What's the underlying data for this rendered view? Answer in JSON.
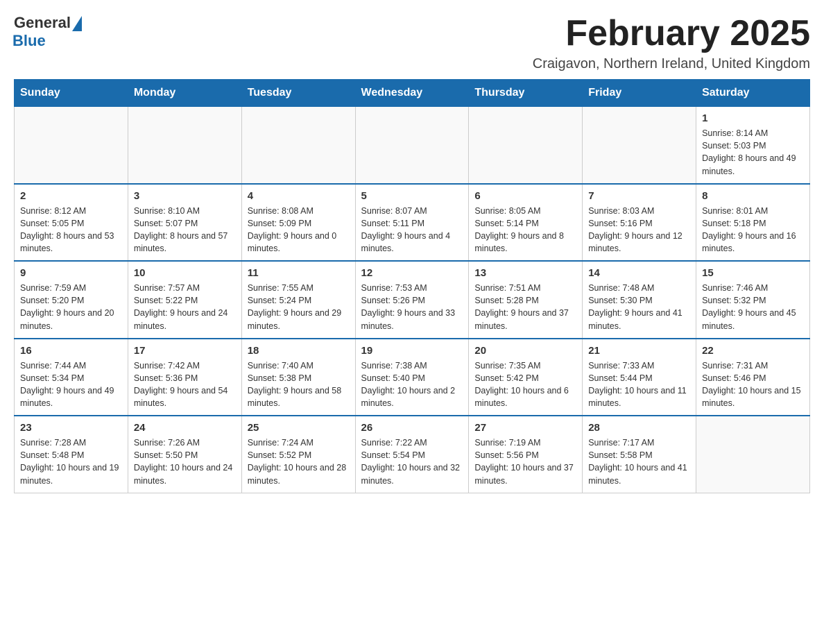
{
  "header": {
    "logo_general": "General",
    "logo_blue": "Blue",
    "month_title": "February 2025",
    "location": "Craigavon, Northern Ireland, United Kingdom"
  },
  "days_of_week": [
    "Sunday",
    "Monday",
    "Tuesday",
    "Wednesday",
    "Thursday",
    "Friday",
    "Saturday"
  ],
  "weeks": [
    [
      {
        "day": "",
        "info": ""
      },
      {
        "day": "",
        "info": ""
      },
      {
        "day": "",
        "info": ""
      },
      {
        "day": "",
        "info": ""
      },
      {
        "day": "",
        "info": ""
      },
      {
        "day": "",
        "info": ""
      },
      {
        "day": "1",
        "info": "Sunrise: 8:14 AM\nSunset: 5:03 PM\nDaylight: 8 hours and 49 minutes."
      }
    ],
    [
      {
        "day": "2",
        "info": "Sunrise: 8:12 AM\nSunset: 5:05 PM\nDaylight: 8 hours and 53 minutes."
      },
      {
        "day": "3",
        "info": "Sunrise: 8:10 AM\nSunset: 5:07 PM\nDaylight: 8 hours and 57 minutes."
      },
      {
        "day": "4",
        "info": "Sunrise: 8:08 AM\nSunset: 5:09 PM\nDaylight: 9 hours and 0 minutes."
      },
      {
        "day": "5",
        "info": "Sunrise: 8:07 AM\nSunset: 5:11 PM\nDaylight: 9 hours and 4 minutes."
      },
      {
        "day": "6",
        "info": "Sunrise: 8:05 AM\nSunset: 5:14 PM\nDaylight: 9 hours and 8 minutes."
      },
      {
        "day": "7",
        "info": "Sunrise: 8:03 AM\nSunset: 5:16 PM\nDaylight: 9 hours and 12 minutes."
      },
      {
        "day": "8",
        "info": "Sunrise: 8:01 AM\nSunset: 5:18 PM\nDaylight: 9 hours and 16 minutes."
      }
    ],
    [
      {
        "day": "9",
        "info": "Sunrise: 7:59 AM\nSunset: 5:20 PM\nDaylight: 9 hours and 20 minutes."
      },
      {
        "day": "10",
        "info": "Sunrise: 7:57 AM\nSunset: 5:22 PM\nDaylight: 9 hours and 24 minutes."
      },
      {
        "day": "11",
        "info": "Sunrise: 7:55 AM\nSunset: 5:24 PM\nDaylight: 9 hours and 29 minutes."
      },
      {
        "day": "12",
        "info": "Sunrise: 7:53 AM\nSunset: 5:26 PM\nDaylight: 9 hours and 33 minutes."
      },
      {
        "day": "13",
        "info": "Sunrise: 7:51 AM\nSunset: 5:28 PM\nDaylight: 9 hours and 37 minutes."
      },
      {
        "day": "14",
        "info": "Sunrise: 7:48 AM\nSunset: 5:30 PM\nDaylight: 9 hours and 41 minutes."
      },
      {
        "day": "15",
        "info": "Sunrise: 7:46 AM\nSunset: 5:32 PM\nDaylight: 9 hours and 45 minutes."
      }
    ],
    [
      {
        "day": "16",
        "info": "Sunrise: 7:44 AM\nSunset: 5:34 PM\nDaylight: 9 hours and 49 minutes."
      },
      {
        "day": "17",
        "info": "Sunrise: 7:42 AM\nSunset: 5:36 PM\nDaylight: 9 hours and 54 minutes."
      },
      {
        "day": "18",
        "info": "Sunrise: 7:40 AM\nSunset: 5:38 PM\nDaylight: 9 hours and 58 minutes."
      },
      {
        "day": "19",
        "info": "Sunrise: 7:38 AM\nSunset: 5:40 PM\nDaylight: 10 hours and 2 minutes."
      },
      {
        "day": "20",
        "info": "Sunrise: 7:35 AM\nSunset: 5:42 PM\nDaylight: 10 hours and 6 minutes."
      },
      {
        "day": "21",
        "info": "Sunrise: 7:33 AM\nSunset: 5:44 PM\nDaylight: 10 hours and 11 minutes."
      },
      {
        "day": "22",
        "info": "Sunrise: 7:31 AM\nSunset: 5:46 PM\nDaylight: 10 hours and 15 minutes."
      }
    ],
    [
      {
        "day": "23",
        "info": "Sunrise: 7:28 AM\nSunset: 5:48 PM\nDaylight: 10 hours and 19 minutes."
      },
      {
        "day": "24",
        "info": "Sunrise: 7:26 AM\nSunset: 5:50 PM\nDaylight: 10 hours and 24 minutes."
      },
      {
        "day": "25",
        "info": "Sunrise: 7:24 AM\nSunset: 5:52 PM\nDaylight: 10 hours and 28 minutes."
      },
      {
        "day": "26",
        "info": "Sunrise: 7:22 AM\nSunset: 5:54 PM\nDaylight: 10 hours and 32 minutes."
      },
      {
        "day": "27",
        "info": "Sunrise: 7:19 AM\nSunset: 5:56 PM\nDaylight: 10 hours and 37 minutes."
      },
      {
        "day": "28",
        "info": "Sunrise: 7:17 AM\nSunset: 5:58 PM\nDaylight: 10 hours and 41 minutes."
      },
      {
        "day": "",
        "info": ""
      }
    ]
  ]
}
